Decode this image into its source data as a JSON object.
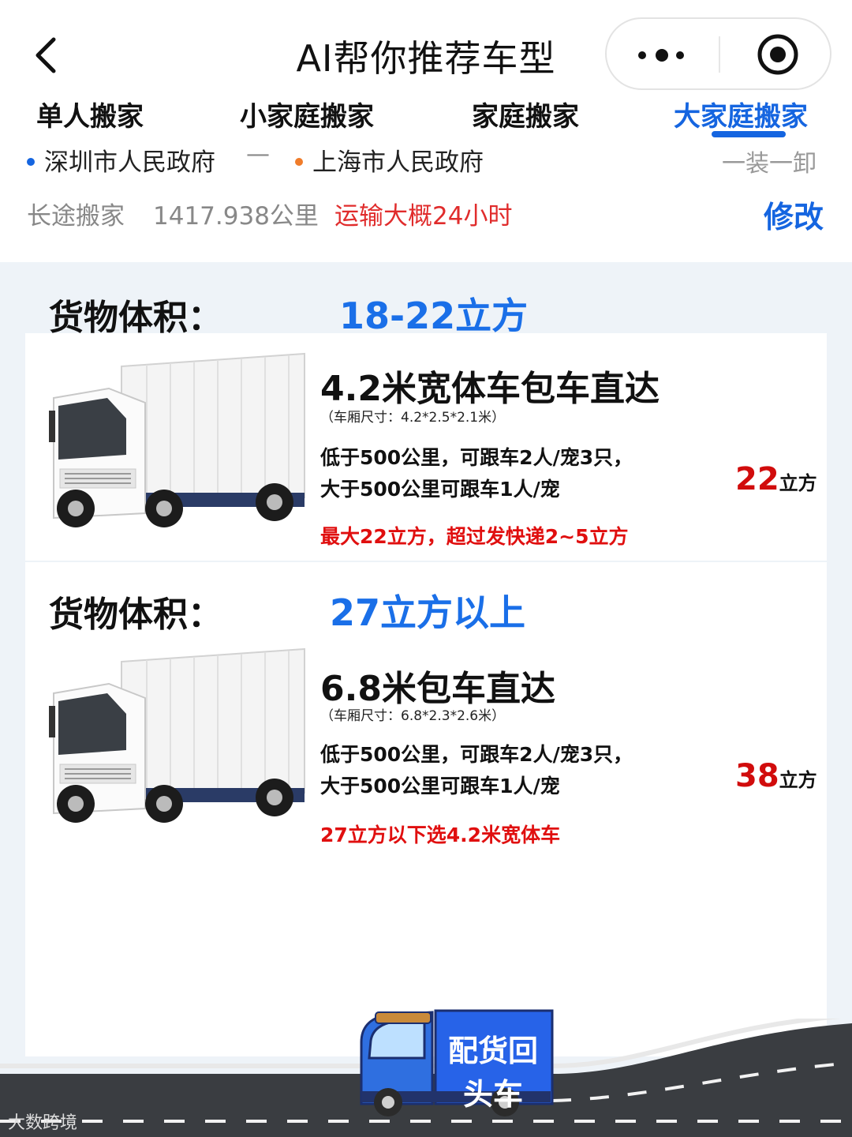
{
  "header": {
    "title": "AI帮你推荐车型"
  },
  "icons": [
    "back-arrow-icon",
    "more-dots-icon",
    "target-icon",
    "truck-icon"
  ],
  "tabs": [
    {
      "label": "单人搬家",
      "active": false
    },
    {
      "label": "小家庭搬家",
      "active": false
    },
    {
      "label": "家庭搬家",
      "active": false
    },
    {
      "label": "大家庭搬家",
      "active": true
    }
  ],
  "route": {
    "from": "深圳市人民政府",
    "from_color": "#1565e0",
    "separator": "—",
    "to": "上海市人民政府",
    "to_color": "#f07c2a",
    "mode": "一装一卸"
  },
  "trip": {
    "type": "长途搬家",
    "distance": "1417.938公里",
    "duration": "运输大概24小时",
    "edit_label": "修改"
  },
  "options": [
    {
      "volume_label": "货物体积：",
      "volume_value": "18-22立方",
      "title": "4.2米宽体车包车直达",
      "size": "（车厢尺寸：4.2*2.5*2.1米）",
      "desc1": "低于500公里，可跟车2人/宠3只，",
      "desc2": "大于500公里可跟车1人/宠",
      "note": "最大22立方，超过发快递2~5立方",
      "capacity_num": "22",
      "capacity_unit": "立方"
    },
    {
      "volume_label": "货物体积：",
      "volume_value": "27立方以上",
      "title": "6.8米包车直达",
      "size": "（车厢尺寸：6.8*2.3*2.6米）",
      "desc1": "低于500公里，可跟车2人/宠3只，",
      "desc2": "大于500公里可跟车1人/宠",
      "note": "27立方以下选4.2米宽体车",
      "capacity_num": "38",
      "capacity_unit": "立方"
    }
  ],
  "badge": {
    "label": "配货回头车"
  },
  "watermark": "大数跨境"
}
